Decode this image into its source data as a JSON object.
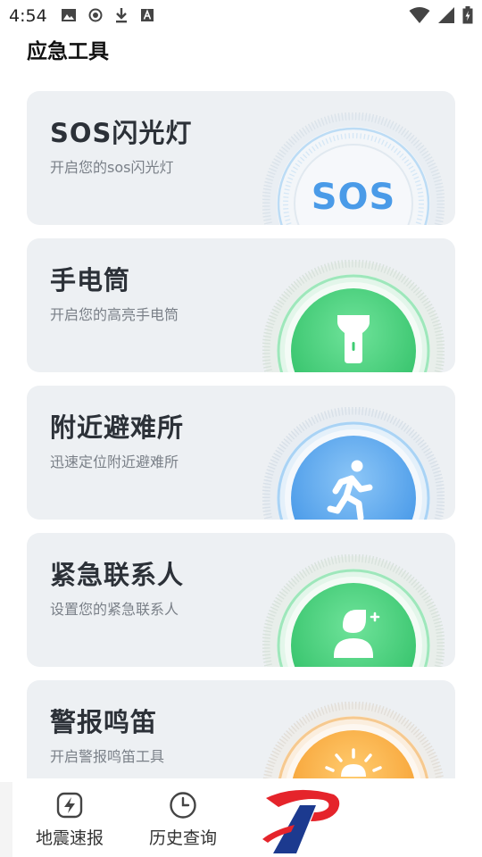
{
  "status_bar": {
    "time": "4:54",
    "icons_left": [
      "image-icon",
      "record-icon",
      "download-icon",
      "font-icon"
    ],
    "icons_right": [
      "wifi-icon",
      "signal-icon",
      "battery-icon"
    ]
  },
  "page": {
    "title": "应急工具"
  },
  "cards": [
    {
      "title": "SOS闪光灯",
      "subtitle": "开启您的sos闪光灯",
      "badge_text": "SOS",
      "accent": "#4a9be8",
      "icon": "sos-text-icon"
    },
    {
      "title": "手电筒",
      "subtitle": "开启您的高亮手电筒",
      "accent": "#3fcc73",
      "icon": "flashlight-icon"
    },
    {
      "title": "附近避难所",
      "subtitle": "迅速定位附近避难所",
      "accent": "#4a9be8",
      "icon": "running-person-icon"
    },
    {
      "title": "紧急联系人",
      "subtitle": "设置您的紧急联系人",
      "accent": "#3fcc73",
      "icon": "add-contact-icon"
    },
    {
      "title": "警报鸣笛",
      "subtitle": "开启警报鸣笛工具",
      "accent": "#f5a431",
      "icon": "alarm-light-icon"
    }
  ],
  "tabs": [
    {
      "label": "地震速报",
      "icon": "lightning-bolt-icon"
    },
    {
      "label": "历史查询",
      "icon": "clock-icon"
    }
  ],
  "brand": {
    "icon": "brand-logo-icon"
  }
}
